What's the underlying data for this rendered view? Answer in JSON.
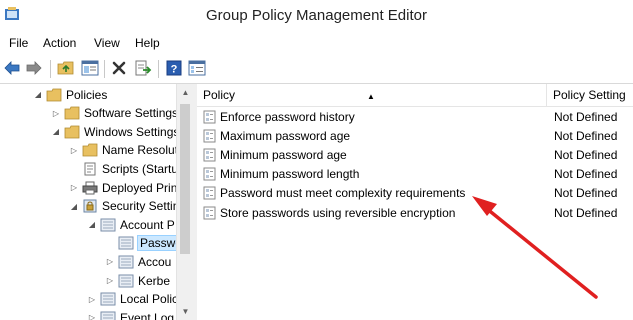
{
  "window": {
    "title": "Group Policy Management Editor"
  },
  "menu": [
    "File",
    "Action",
    "View",
    "Help"
  ],
  "toolbar": {
    "buttons": [
      "back-icon",
      "forward-icon",
      "up-folder-icon",
      "show-hide-tree-icon",
      "delete-icon",
      "export-list-icon",
      "help-icon",
      "properties-icon"
    ]
  },
  "tree": {
    "items": [
      {
        "label": "Policies",
        "level": 2,
        "expander": "expanded",
        "icon": "folder-icon"
      },
      {
        "label": "Software Settings",
        "level": 3,
        "expander": "collapsed",
        "icon": "folder-icon"
      },
      {
        "label": "Windows Settings",
        "level": 3,
        "expander": "expanded",
        "icon": "folder-icon"
      },
      {
        "label": "Name Resolut",
        "level": 4,
        "expander": "collapsed",
        "icon": "folder-icon"
      },
      {
        "label": "Scripts (Startu",
        "level": 4,
        "expander": "none",
        "icon": "scripts-icon"
      },
      {
        "label": "Deployed Prin",
        "level": 4,
        "expander": "collapsed",
        "icon": "printer-icon"
      },
      {
        "label": "Security Settin",
        "level": 4,
        "expander": "expanded",
        "icon": "security-settings-icon"
      },
      {
        "label": "Account P",
        "level": 5,
        "expander": "expanded",
        "icon": "policy-folder-icon"
      },
      {
        "label": "Passwo",
        "level": 6,
        "expander": "none",
        "icon": "policy-folder-icon",
        "selected": true
      },
      {
        "label": "Accou",
        "level": 6,
        "expander": "collapsed",
        "icon": "policy-folder-icon"
      },
      {
        "label": "Kerbe",
        "level": 6,
        "expander": "collapsed",
        "icon": "policy-folder-icon"
      },
      {
        "label": "Local Polic",
        "level": 5,
        "expander": "collapsed",
        "icon": "policy-folder-icon"
      },
      {
        "label": "Event Log",
        "level": 5,
        "expander": "collapsed",
        "icon": "policy-folder-icon"
      }
    ]
  },
  "list": {
    "columns": {
      "policy": "Policy",
      "setting": "Policy Setting"
    },
    "rows": [
      {
        "policy": "Enforce password history",
        "setting": "Not Defined"
      },
      {
        "policy": "Maximum password age",
        "setting": "Not Defined"
      },
      {
        "policy": "Minimum password age",
        "setting": "Not Defined"
      },
      {
        "policy": "Minimum password length",
        "setting": "Not Defined"
      },
      {
        "policy": "Password must meet complexity requirements",
        "setting": "Not Defined"
      },
      {
        "policy": "Store passwords using reversible encryption",
        "setting": "Not Defined"
      }
    ]
  },
  "colors": {
    "annotation_arrow": "#e02020",
    "selection_fill": "#cce8ff",
    "folder": "#e8c060",
    "help_blue": "#2a5db0"
  }
}
